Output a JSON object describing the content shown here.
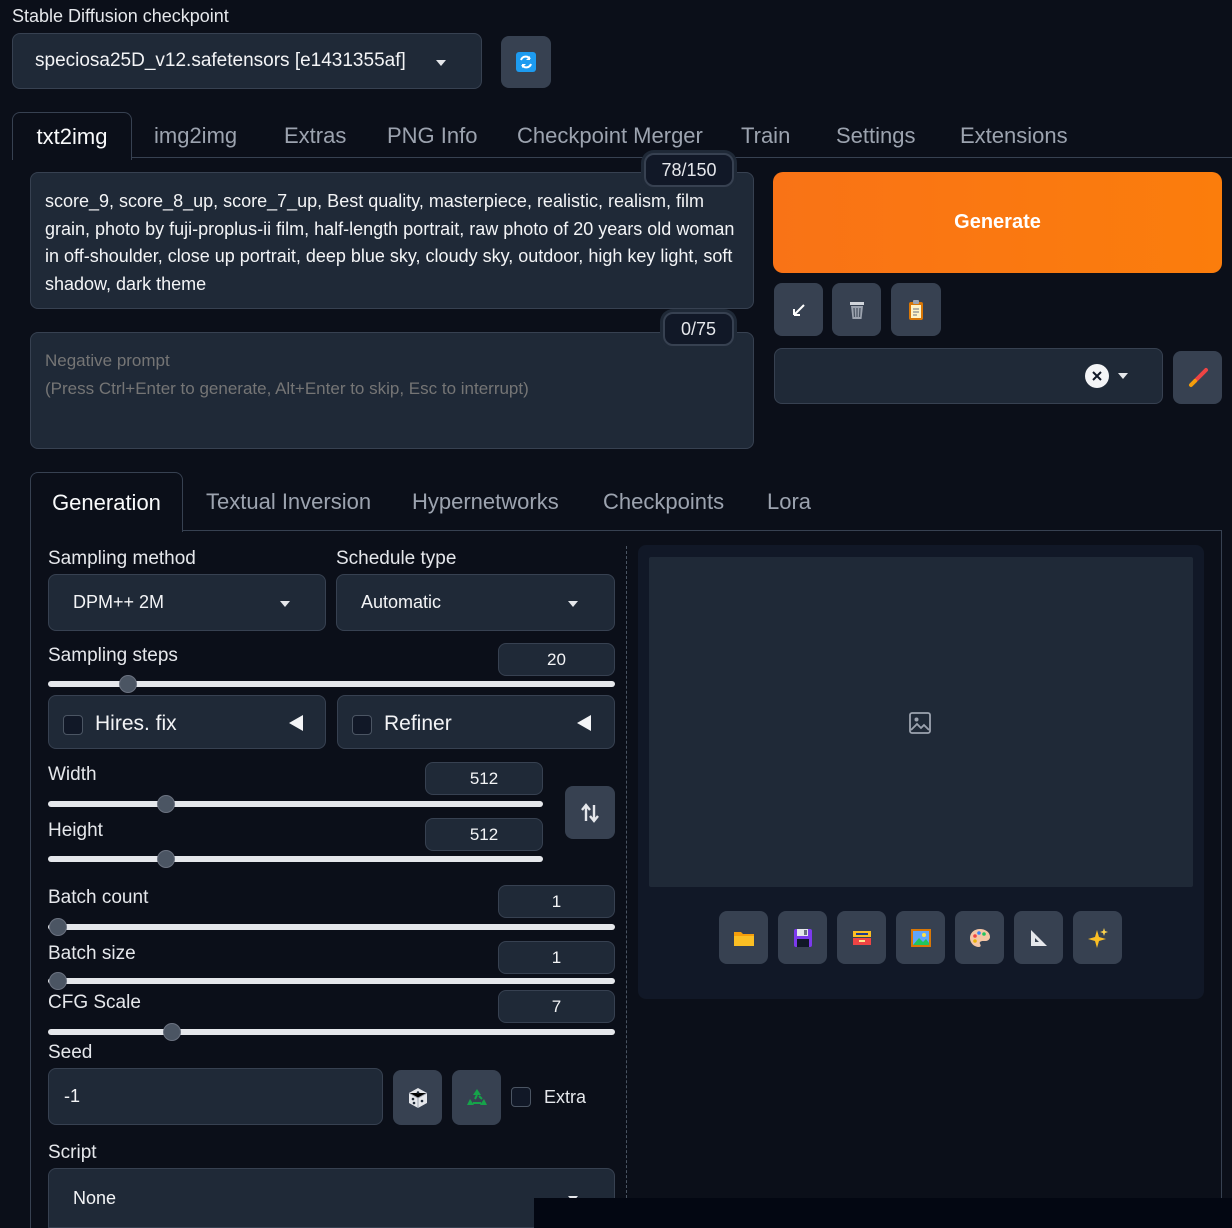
{
  "checkpoint": {
    "label": "Stable Diffusion checkpoint",
    "value": "speciosa25D_v12.safetensors [e1431355af]"
  },
  "top_tabs": [
    "txt2img",
    "img2img",
    "Extras",
    "PNG Info",
    "Checkpoint Merger",
    "Train",
    "Settings",
    "Extensions"
  ],
  "prompt": {
    "text": "score_9, score_8_up, score_7_up, Best quality, masterpiece, realistic, realism, film grain, photo by fuji-proplus-ii film, half-length portrait, raw photo of 20 years old woman in off-shoulder, close up portrait, deep blue sky, cloudy sky, outdoor, high key light, soft shadow, dark theme",
    "counter": "78/150"
  },
  "negative_prompt": {
    "placeholder": "Negative prompt\n(Press Ctrl+Enter to generate, Alt+Enter to skip, Esc to interrupt)",
    "counter": "0/75"
  },
  "generate_label": "Generate",
  "sub_tabs": [
    "Generation",
    "Textual Inversion",
    "Hypernetworks",
    "Checkpoints",
    "Lora"
  ],
  "sampling_method": {
    "label": "Sampling method",
    "value": "DPM++ 2M"
  },
  "schedule_type": {
    "label": "Schedule type",
    "value": "Automatic"
  },
  "sampling_steps": {
    "label": "Sampling steps",
    "value": "20"
  },
  "hires_fix": {
    "label": "Hires. fix"
  },
  "refiner": {
    "label": "Refiner"
  },
  "width": {
    "label": "Width",
    "value": "512"
  },
  "height": {
    "label": "Height",
    "value": "512"
  },
  "batch_count": {
    "label": "Batch count",
    "value": "1"
  },
  "batch_size": {
    "label": "Batch size",
    "value": "1"
  },
  "cfg_scale": {
    "label": "CFG Scale",
    "value": "7"
  },
  "seed": {
    "label": "Seed",
    "value": "-1",
    "extra_label": "Extra"
  },
  "script": {
    "label": "Script",
    "value": "None"
  },
  "colors": {
    "background": "#0b0f19",
    "panel": "#1f2937",
    "generate_start": "#f97316",
    "generate_end": "#fb7d0c"
  }
}
